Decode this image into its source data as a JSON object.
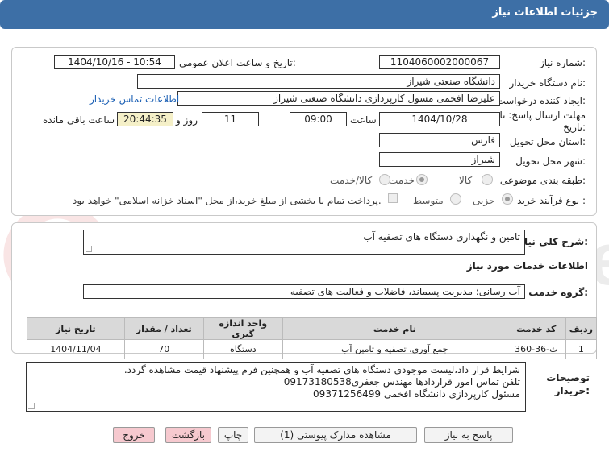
{
  "header": {
    "title": "جزئیات اطلاعات نیاز"
  },
  "form": {
    "need_number_label": "شماره نیاز:",
    "need_number": "1104060002000067",
    "announce_label": "تاریخ و ساعت اعلان عمومی:",
    "announce_value": "1404/10/16 - 10:54",
    "buyer_org_label": "نام دستگاه خریدار:",
    "buyer_org": "دانشگاه صنعتی شیراز",
    "creator_label": "ایجاد کننده درخواست:",
    "creator": "علیرضا افخمی مسول کارپردازی دانشگاه صنعتی شیراز",
    "contact_link": "اطلاعات تماس خریدار",
    "deadline_label_1": "مهلت ارسال پاسخ: تا",
    "deadline_label_2": "تاریخ:",
    "deadline_date": "1404/10/28",
    "time_label": "ساعت",
    "deadline_time": "09:00",
    "days_value": "11",
    "days_label": "روز و",
    "remaining_time": "20:44:35",
    "remaining_label": "ساعت باقی مانده",
    "province_label": "استان محل تحویل:",
    "province": "فارس",
    "city_label": "شهر محل تحویل:",
    "city": "شیراز",
    "category_label": "طبقه بندی موضوعی:",
    "category_options": [
      "کالا",
      "خدمت",
      "کالا/خدمت"
    ],
    "process_label": "نوع فرآیند خرید :",
    "process_options": [
      "جزیی",
      "متوسط"
    ],
    "payment_text": "پرداخت تمام یا بخشی از مبلغ خرید،از محل \"اسناد خزانه اسلامی\" خواهد بود."
  },
  "summary": {
    "label": "شرح کلی نیاز:",
    "value": "تامین و نگهداری دستگاه های تصفیه آب"
  },
  "services": {
    "section_title": "اطلاعات خدمات مورد نیاز",
    "group_label": "گروه خدمت:",
    "group_value": "آب رسانی؛ مدیریت پسماند، فاضلاب و فعالیت های تصفیه",
    "columns": [
      "ردیف",
      "کد خدمت",
      "نام خدمت",
      "واحد اندازه گیری",
      "تعداد / مقدار",
      "تاریخ نیاز"
    ],
    "rows": [
      [
        "1",
        "ث-36-360",
        "جمع آوری، تصفیه و تامین آب",
        "دستگاه",
        "70",
        "1404/11/04"
      ]
    ]
  },
  "buyer_notes": {
    "label_1": "توضیحات",
    "label_2": "خریدار:",
    "lines": [
      "شرایط قرار داد،لیست موجودی دستگاه های تصفیه آب و همچنین فرم پیشنهاد قیمت مشاهده گردد.",
      "تلفن تماس امور قراردادها مهندس جعفری09173180538",
      "مسئول کارپردازی دانشگاه افخمی 09371256499"
    ]
  },
  "buttons": {
    "reply": "پاسخ به نیاز",
    "attachments": "مشاهده مدارک پیوستی (1)",
    "print": "چاپ",
    "back": "بازگشت",
    "exit": "خروج"
  },
  "watermark": "AriaTender.net",
  "colors": {
    "header": "#3d6fa6",
    "remaining_bg": "#f5f0c8",
    "pink_button": "#f6c9cf"
  }
}
